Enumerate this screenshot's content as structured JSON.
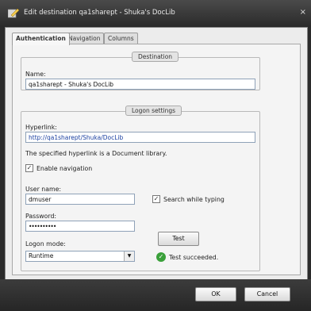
{
  "window": {
    "title": "Edit destination qa1sharept - Shuka's DocLib",
    "close_glyph": "×"
  },
  "tabs": [
    {
      "label": "Authentication"
    },
    {
      "label": "Navigation"
    },
    {
      "label": "Columns"
    }
  ],
  "destination": {
    "group_label": "Destination",
    "name_label": "Name:",
    "name_value": "qa1sharept - Shuka's DocLib"
  },
  "logon": {
    "group_label": "Logon settings",
    "hyperlink_label": "Hyperlink:",
    "hyperlink_value": "http://qa1sharept/Shuka/DocLib",
    "hyperlink_note": "The specified hyperlink is a Document library.",
    "enable_navigation_label": "Enable navigation",
    "enable_navigation_checked": true,
    "username_label": "User name:",
    "username_value": "dmuser",
    "search_while_typing_label": "Search while typing",
    "search_while_typing_checked": true,
    "password_label": "Password:",
    "password_value": "••••••••••",
    "test_button": "Test",
    "logon_mode_label": "Logon mode:",
    "logon_mode_value": "Runtime",
    "test_status": "Test succeeded."
  },
  "footer": {
    "ok_label": "OK",
    "cancel_label": "Cancel"
  },
  "colors": {
    "success": "#3aa03a",
    "link": "#1a3fa0"
  },
  "icons": {
    "check": "✓",
    "dropdown": "▼",
    "window": "edit-destination-icon"
  }
}
